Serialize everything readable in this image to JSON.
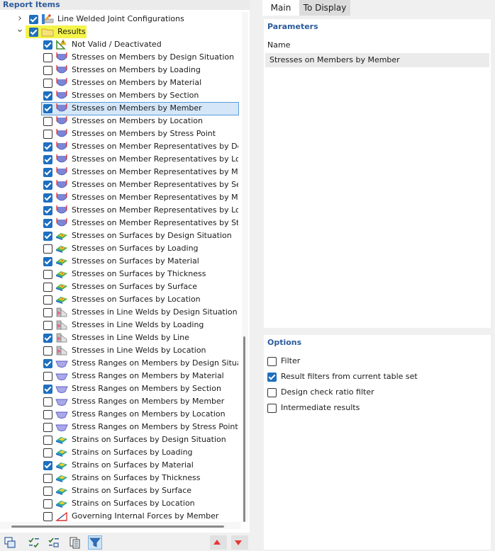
{
  "left_panel": {
    "title": "Report Items"
  },
  "tree": [
    {
      "label": "Line Welded Joint Configurations",
      "checked": true,
      "icon": "joint-config-icon",
      "level": 0,
      "expander": "collapsed"
    },
    {
      "label": "Results",
      "checked": true,
      "icon": "folder-icon",
      "level": 0,
      "expander": "expanded",
      "highlight": true
    },
    {
      "label": "Not Valid / Deactivated",
      "checked": true,
      "icon": "not-valid-icon",
      "level": 1
    },
    {
      "label": "Stresses on Members by Design Situation",
      "checked": false,
      "icon": "member-stress-icon",
      "level": 1
    },
    {
      "label": "Stresses on Members by Loading",
      "checked": false,
      "icon": "member-stress-icon",
      "level": 1
    },
    {
      "label": "Stresses on Members by Material",
      "checked": false,
      "icon": "member-stress-icon",
      "level": 1
    },
    {
      "label": "Stresses on Members by Section",
      "checked": true,
      "icon": "member-stress-icon",
      "level": 1
    },
    {
      "label": "Stresses on Members by Member",
      "checked": true,
      "icon": "member-stress-icon",
      "level": 1,
      "selected": true
    },
    {
      "label": "Stresses on Members by Location",
      "checked": false,
      "icon": "member-stress-icon",
      "level": 1
    },
    {
      "label": "Stresses on Members by Stress Point",
      "checked": false,
      "icon": "member-stress-icon",
      "level": 1
    },
    {
      "label": "Stresses on Member Representatives by Desig",
      "checked": true,
      "icon": "member-stress-icon",
      "level": 1
    },
    {
      "label": "Stresses on Member Representatives by Loadi",
      "checked": true,
      "icon": "member-stress-icon",
      "level": 1
    },
    {
      "label": "Stresses on Member Representatives by Mater",
      "checked": true,
      "icon": "member-stress-icon",
      "level": 1
    },
    {
      "label": "Stresses on Member Representatives by Sectio",
      "checked": true,
      "icon": "member-stress-icon",
      "level": 1
    },
    {
      "label": "Stresses on Member Representatives by Memb",
      "checked": true,
      "icon": "member-stress-icon",
      "level": 1
    },
    {
      "label": "Stresses on Member Representatives by Locati",
      "checked": true,
      "icon": "member-stress-icon",
      "level": 1
    },
    {
      "label": "Stresses on Member Representatives by Stress",
      "checked": true,
      "icon": "member-stress-icon",
      "level": 1
    },
    {
      "label": "Stresses on Surfaces by Design Situation",
      "checked": true,
      "icon": "surface-stress-icon",
      "level": 1
    },
    {
      "label": "Stresses on Surfaces by Loading",
      "checked": false,
      "icon": "surface-stress-icon",
      "level": 1
    },
    {
      "label": "Stresses on Surfaces by Material",
      "checked": true,
      "icon": "surface-stress-icon",
      "level": 1
    },
    {
      "label": "Stresses on Surfaces by Thickness",
      "checked": false,
      "icon": "surface-stress-icon",
      "level": 1
    },
    {
      "label": "Stresses on Surfaces by Surface",
      "checked": false,
      "icon": "surface-stress-icon",
      "level": 1
    },
    {
      "label": "Stresses on Surfaces by Location",
      "checked": false,
      "icon": "surface-stress-icon",
      "level": 1
    },
    {
      "label": "Stresses in Line Welds by Design Situation",
      "checked": false,
      "icon": "weld-stress-icon",
      "level": 1
    },
    {
      "label": "Stresses in Line Welds by Loading",
      "checked": false,
      "icon": "weld-stress-icon",
      "level": 1
    },
    {
      "label": "Stresses in Line Welds by Line",
      "checked": true,
      "icon": "weld-stress-icon",
      "level": 1
    },
    {
      "label": "Stresses in Line Welds by Location",
      "checked": false,
      "icon": "weld-stress-icon",
      "level": 1
    },
    {
      "label": "Stress Ranges on Members by Design Situatio",
      "checked": true,
      "icon": "stress-range-icon",
      "level": 1
    },
    {
      "label": "Stress Ranges on Members by Material",
      "checked": false,
      "icon": "stress-range-icon",
      "level": 1
    },
    {
      "label": "Stress Ranges on Members by Section",
      "checked": true,
      "icon": "stress-range-icon",
      "level": 1
    },
    {
      "label": "Stress Ranges on Members by Member",
      "checked": false,
      "icon": "stress-range-icon",
      "level": 1
    },
    {
      "label": "Stress Ranges on Members by Location",
      "checked": false,
      "icon": "stress-range-icon",
      "level": 1
    },
    {
      "label": "Stress Ranges on Members by Stress Point",
      "checked": false,
      "icon": "stress-range-icon",
      "level": 1
    },
    {
      "label": "Strains on Surfaces by Design Situation",
      "checked": false,
      "icon": "surface-strain-icon",
      "level": 1
    },
    {
      "label": "Strains on Surfaces by Loading",
      "checked": false,
      "icon": "surface-strain-icon",
      "level": 1
    },
    {
      "label": "Strains on Surfaces by Material",
      "checked": true,
      "icon": "surface-strain-icon",
      "level": 1
    },
    {
      "label": "Strains on Surfaces by Thickness",
      "checked": false,
      "icon": "surface-strain-icon",
      "level": 1
    },
    {
      "label": "Strains on Surfaces by Surface",
      "checked": false,
      "icon": "surface-strain-icon",
      "level": 1
    },
    {
      "label": "Strains on Surfaces by Location",
      "checked": false,
      "icon": "surface-strain-icon",
      "level": 1
    },
    {
      "label": "Governing Internal Forces by Member",
      "checked": false,
      "icon": "internal-forces-icon",
      "level": 1
    }
  ],
  "toolbar": {
    "buttons": [
      {
        "name": "windows-icon",
        "active": false
      },
      {
        "name": "check-all-icon",
        "active": false
      },
      {
        "name": "uncheck-all-icon",
        "active": false
      },
      {
        "name": "copy-list-icon",
        "active": false
      },
      {
        "name": "filter-icon",
        "active": true
      },
      {
        "name": "move-up-icon",
        "active": false
      },
      {
        "name": "move-down-icon",
        "active": false
      }
    ]
  },
  "tabs": [
    {
      "label": "Main",
      "active": true
    },
    {
      "label": "To Display",
      "active": false
    }
  ],
  "parameters": {
    "title": "Parameters",
    "name_label": "Name",
    "name_value": "Stresses on Members by Member"
  },
  "options": {
    "title": "Options",
    "items": [
      {
        "label": "Filter",
        "checked": false
      },
      {
        "label": "Result filters from current table set",
        "checked": true
      },
      {
        "label": "Design check ratio filter",
        "checked": false
      },
      {
        "label": "Intermediate results",
        "checked": false
      }
    ]
  },
  "colors": {
    "accent": "#1e6fbf",
    "title_blue": "#2c5b9c",
    "selection": "#d4e6f8",
    "highlight": "#f4f44a"
  }
}
